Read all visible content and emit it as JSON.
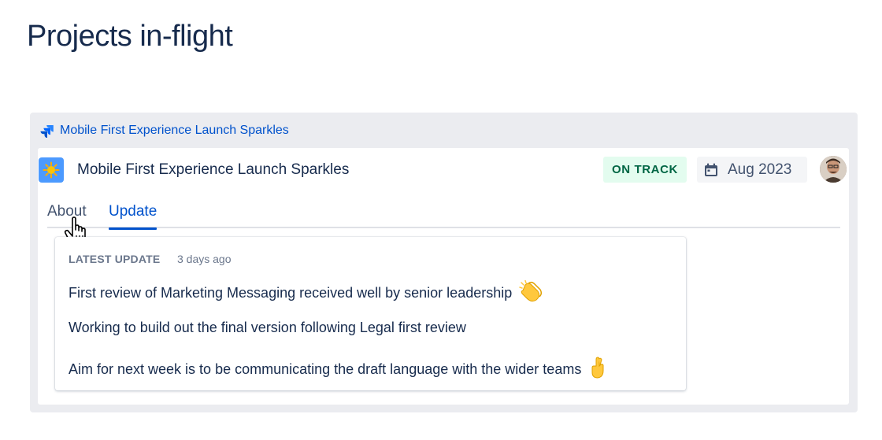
{
  "page": {
    "title": "Projects in-flight"
  },
  "card": {
    "link_text": "Mobile First Experience Launch Sparkles",
    "project_title": "Mobile First Experience Launch Sparkles",
    "project_icon": "sparkle-sun-icon",
    "status": "ON TRACK",
    "due_date": "Aug 2023",
    "colors": {
      "status_bg": "#e3fcef",
      "status_fg": "#006644",
      "link": "#0052cc",
      "card_bg": "#ebecf0"
    }
  },
  "tabs": [
    {
      "label": "About",
      "active": false
    },
    {
      "label": "Update",
      "active": true
    }
  ],
  "update": {
    "label": "LATEST UPDATE",
    "time": "3 days ago",
    "lines": [
      {
        "text": "First review of Marketing Messaging received well by senior leadership",
        "emoji": "clapping-hands-icon"
      },
      {
        "text": "Working to build out the final version following Legal first review",
        "emoji": ""
      },
      {
        "text": "Aim for next week is to be communicating the draft language with the wider teams",
        "emoji": "crossed-fingers-icon"
      }
    ]
  }
}
